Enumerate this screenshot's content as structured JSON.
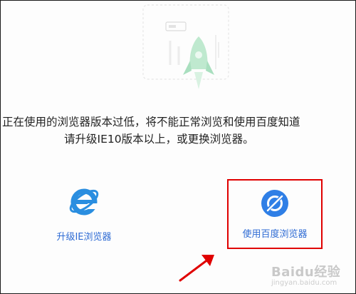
{
  "message": {
    "line1": "正在使用的浏览器版本过低，将不能正常浏览和使用百度知道",
    "line2": "请升级IE10版本以上，或更换浏览器。"
  },
  "options": {
    "ie": {
      "label": "升级IE浏览器",
      "icon": "internet-explorer-icon"
    },
    "baidu": {
      "label": "使用百度浏览器",
      "icon": "baidu-browser-icon"
    }
  },
  "watermark": {
    "text": "Baidu经验",
    "sub": "jingyan.baidu.com"
  },
  "colors": {
    "link": "#2e6bd4",
    "highlight": "#e00000",
    "rocket": "#a9dfbf",
    "ie_blue": "#2a8ee0",
    "baidu_blue": "#2f7fe6"
  }
}
